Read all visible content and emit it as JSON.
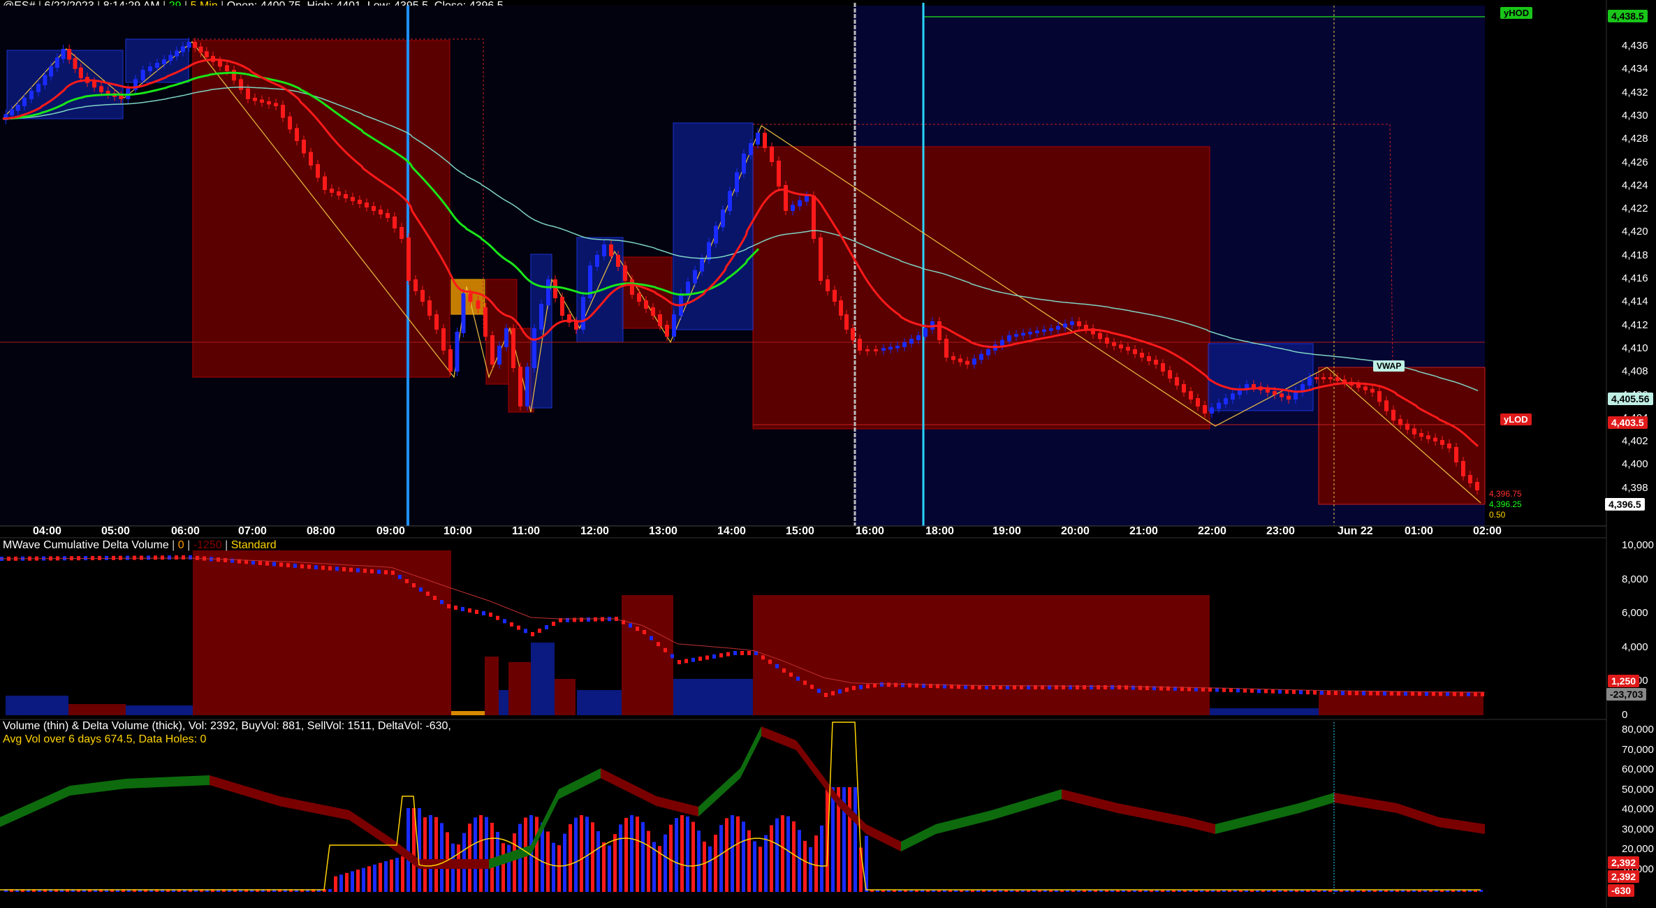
{
  "header": {
    "symbol": "@ES#",
    "date": "6/22/2023",
    "time": "8:14:29 AM",
    "bar_count": "29",
    "interval": "5 Min",
    "ohlc": "Open: 4400.75, High: 4401, Low: 4395.5, Close: 4396.5"
  },
  "price_axis": {
    "ticks": [
      "4,436",
      "4,434",
      "4,432",
      "4,430",
      "4,428",
      "4,426",
      "4,424",
      "4,422",
      "4,420",
      "4,418",
      "4,416",
      "4,414",
      "4,412",
      "4,410",
      "4,408",
      "4,406",
      "4,404",
      "4,402",
      "4,400",
      "4,398"
    ],
    "tick_values": [
      4436,
      4434,
      4432,
      4430,
      4428,
      4426,
      4424,
      4422,
      4420,
      4418,
      4416,
      4414,
      4412,
      4410,
      4408,
      4406,
      4404,
      4402,
      4400,
      4398
    ],
    "hod_value": "4,438.5",
    "vwap_value": "4,405.56",
    "lod_value": "4,403.5",
    "last_value": "4,396.5",
    "hod_label": "yHOD",
    "lod_label": "yLOD",
    "vwap_label": "VWAP",
    "mini_high": "4,396.75",
    "mini_mid": "4,396.25",
    "mini_low": "0.50"
  },
  "time_axis": [
    "04:00",
    "05:00",
    "06:00",
    "07:00",
    "08:00",
    "09:00",
    "10:00",
    "11:00",
    "12:00",
    "13:00",
    "14:00",
    "15:00",
    "16:00",
    "18:00",
    "19:00",
    "20:00",
    "21:00",
    "22:00",
    "23:00",
    "Jun 22",
    "01:00",
    "02:00"
  ],
  "delta_panel": {
    "title": "MWave Cumulative Delta Volume",
    "param1": "0",
    "param2": "-1250",
    "param3": "Standard",
    "ticks": [
      "10,000",
      "8,000",
      "6,000",
      "4,000",
      "2,000",
      "0"
    ],
    "tag_red": "1,250",
    "tag_gray": "-23,703"
  },
  "volume_panel": {
    "title": "Volume (thin) & Delta Volume (thick), Vol: 2392, BuyVol: 881, SellVol: 1511, DeltaVol: -630,",
    "subtitle": "Avg Vol over 6 days 674.5, Data Holes: 0",
    "ticks": [
      "80,000",
      "70,000",
      "60,000",
      "50,000",
      "40,000",
      "30,000",
      "20,000",
      "10,000",
      "0"
    ],
    "tag1": "2,392",
    "tag2": "2,392",
    "tag3": "-630"
  },
  "colors": {
    "up": "#1a2bff",
    "down": "#ff1a1a",
    "ema_fast": "#ff1a1a",
    "ema_slow": "#19e619",
    "vwap": "#7fd4c4",
    "session_line": "#1e90ff",
    "grid_bg": "#000000",
    "bar_red_box": "#6b0000",
    "bar_blue_box": "#001a66"
  }
}
